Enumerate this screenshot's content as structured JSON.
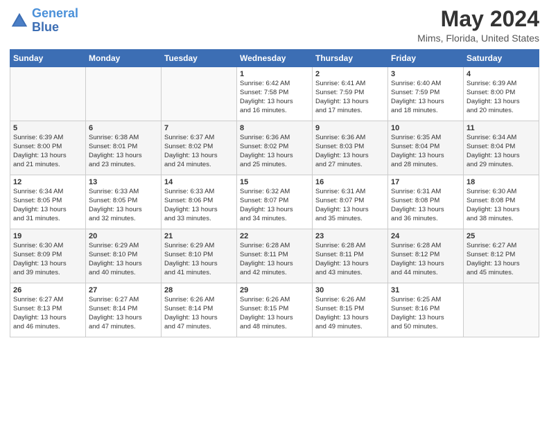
{
  "logo": {
    "line1": "General",
    "line2": "Blue"
  },
  "title": "May 2024",
  "location": "Mims, Florida, United States",
  "days_of_week": [
    "Sunday",
    "Monday",
    "Tuesday",
    "Wednesday",
    "Thursday",
    "Friday",
    "Saturday"
  ],
  "weeks": [
    [
      {
        "day": "",
        "info": ""
      },
      {
        "day": "",
        "info": ""
      },
      {
        "day": "",
        "info": ""
      },
      {
        "day": "1",
        "info": "Sunrise: 6:42 AM\nSunset: 7:58 PM\nDaylight: 13 hours\nand 16 minutes."
      },
      {
        "day": "2",
        "info": "Sunrise: 6:41 AM\nSunset: 7:59 PM\nDaylight: 13 hours\nand 17 minutes."
      },
      {
        "day": "3",
        "info": "Sunrise: 6:40 AM\nSunset: 7:59 PM\nDaylight: 13 hours\nand 18 minutes."
      },
      {
        "day": "4",
        "info": "Sunrise: 6:39 AM\nSunset: 8:00 PM\nDaylight: 13 hours\nand 20 minutes."
      }
    ],
    [
      {
        "day": "5",
        "info": "Sunrise: 6:39 AM\nSunset: 8:00 PM\nDaylight: 13 hours\nand 21 minutes."
      },
      {
        "day": "6",
        "info": "Sunrise: 6:38 AM\nSunset: 8:01 PM\nDaylight: 13 hours\nand 23 minutes."
      },
      {
        "day": "7",
        "info": "Sunrise: 6:37 AM\nSunset: 8:02 PM\nDaylight: 13 hours\nand 24 minutes."
      },
      {
        "day": "8",
        "info": "Sunrise: 6:36 AM\nSunset: 8:02 PM\nDaylight: 13 hours\nand 25 minutes."
      },
      {
        "day": "9",
        "info": "Sunrise: 6:36 AM\nSunset: 8:03 PM\nDaylight: 13 hours\nand 27 minutes."
      },
      {
        "day": "10",
        "info": "Sunrise: 6:35 AM\nSunset: 8:04 PM\nDaylight: 13 hours\nand 28 minutes."
      },
      {
        "day": "11",
        "info": "Sunrise: 6:34 AM\nSunset: 8:04 PM\nDaylight: 13 hours\nand 29 minutes."
      }
    ],
    [
      {
        "day": "12",
        "info": "Sunrise: 6:34 AM\nSunset: 8:05 PM\nDaylight: 13 hours\nand 31 minutes."
      },
      {
        "day": "13",
        "info": "Sunrise: 6:33 AM\nSunset: 8:05 PM\nDaylight: 13 hours\nand 32 minutes."
      },
      {
        "day": "14",
        "info": "Sunrise: 6:33 AM\nSunset: 8:06 PM\nDaylight: 13 hours\nand 33 minutes."
      },
      {
        "day": "15",
        "info": "Sunrise: 6:32 AM\nSunset: 8:07 PM\nDaylight: 13 hours\nand 34 minutes."
      },
      {
        "day": "16",
        "info": "Sunrise: 6:31 AM\nSunset: 8:07 PM\nDaylight: 13 hours\nand 35 minutes."
      },
      {
        "day": "17",
        "info": "Sunrise: 6:31 AM\nSunset: 8:08 PM\nDaylight: 13 hours\nand 36 minutes."
      },
      {
        "day": "18",
        "info": "Sunrise: 6:30 AM\nSunset: 8:08 PM\nDaylight: 13 hours\nand 38 minutes."
      }
    ],
    [
      {
        "day": "19",
        "info": "Sunrise: 6:30 AM\nSunset: 8:09 PM\nDaylight: 13 hours\nand 39 minutes."
      },
      {
        "day": "20",
        "info": "Sunrise: 6:29 AM\nSunset: 8:10 PM\nDaylight: 13 hours\nand 40 minutes."
      },
      {
        "day": "21",
        "info": "Sunrise: 6:29 AM\nSunset: 8:10 PM\nDaylight: 13 hours\nand 41 minutes."
      },
      {
        "day": "22",
        "info": "Sunrise: 6:28 AM\nSunset: 8:11 PM\nDaylight: 13 hours\nand 42 minutes."
      },
      {
        "day": "23",
        "info": "Sunrise: 6:28 AM\nSunset: 8:11 PM\nDaylight: 13 hours\nand 43 minutes."
      },
      {
        "day": "24",
        "info": "Sunrise: 6:28 AM\nSunset: 8:12 PM\nDaylight: 13 hours\nand 44 minutes."
      },
      {
        "day": "25",
        "info": "Sunrise: 6:27 AM\nSunset: 8:12 PM\nDaylight: 13 hours\nand 45 minutes."
      }
    ],
    [
      {
        "day": "26",
        "info": "Sunrise: 6:27 AM\nSunset: 8:13 PM\nDaylight: 13 hours\nand 46 minutes."
      },
      {
        "day": "27",
        "info": "Sunrise: 6:27 AM\nSunset: 8:14 PM\nDaylight: 13 hours\nand 47 minutes."
      },
      {
        "day": "28",
        "info": "Sunrise: 6:26 AM\nSunset: 8:14 PM\nDaylight: 13 hours\nand 47 minutes."
      },
      {
        "day": "29",
        "info": "Sunrise: 6:26 AM\nSunset: 8:15 PM\nDaylight: 13 hours\nand 48 minutes."
      },
      {
        "day": "30",
        "info": "Sunrise: 6:26 AM\nSunset: 8:15 PM\nDaylight: 13 hours\nand 49 minutes."
      },
      {
        "day": "31",
        "info": "Sunrise: 6:25 AM\nSunset: 8:16 PM\nDaylight: 13 hours\nand 50 minutes."
      },
      {
        "day": "",
        "info": ""
      }
    ]
  ]
}
